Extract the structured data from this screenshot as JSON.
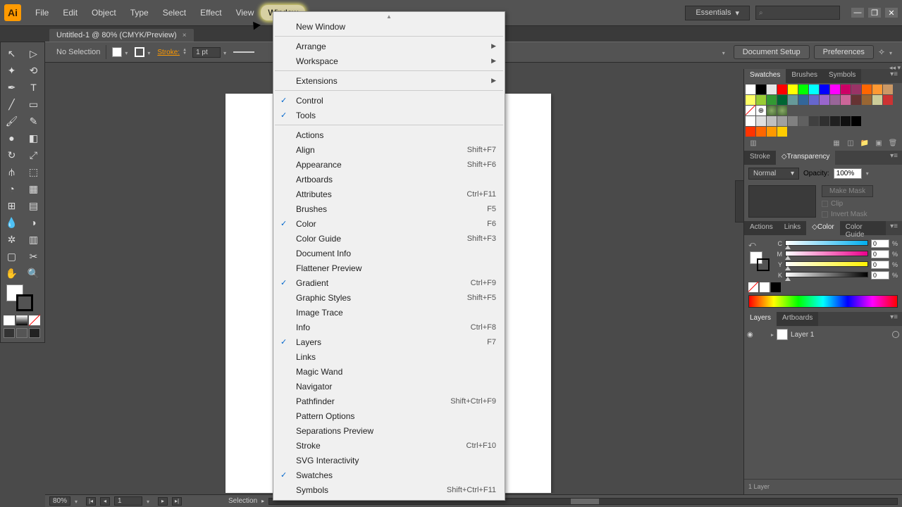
{
  "app": {
    "logo": "Ai"
  },
  "menu": {
    "items": [
      "File",
      "Edit",
      "Object",
      "Type",
      "Select",
      "Effect",
      "View",
      "Window"
    ],
    "active_index": 7
  },
  "workspace_switcher": "Essentials",
  "doc_tab": {
    "title": "Untitled-1 @ 80% (CMYK/Preview)"
  },
  "controlbar": {
    "selection": "No Selection",
    "stroke_label": "Stroke:",
    "stroke_weight": "1 pt",
    "doc_setup": "Document Setup",
    "prefs": "Preferences"
  },
  "window_menu": {
    "groups": [
      {
        "items": [
          {
            "label": "New Window"
          }
        ]
      },
      {
        "items": [
          {
            "label": "Arrange",
            "sub": true
          },
          {
            "label": "Workspace",
            "sub": true
          }
        ]
      },
      {
        "items": [
          {
            "label": "Extensions",
            "sub": true
          }
        ]
      },
      {
        "items": [
          {
            "label": "Control",
            "checked": true
          },
          {
            "label": "Tools",
            "checked": true
          }
        ]
      },
      {
        "items": [
          {
            "label": "Actions"
          },
          {
            "label": "Align",
            "shortcut": "Shift+F7"
          },
          {
            "label": "Appearance",
            "shortcut": "Shift+F6"
          },
          {
            "label": "Artboards"
          },
          {
            "label": "Attributes",
            "shortcut": "Ctrl+F11"
          },
          {
            "label": "Brushes",
            "shortcut": "F5"
          },
          {
            "label": "Color",
            "checked": true,
            "shortcut": "F6"
          },
          {
            "label": "Color Guide",
            "shortcut": "Shift+F3"
          },
          {
            "label": "Document Info"
          },
          {
            "label": "Flattener Preview"
          },
          {
            "label": "Gradient",
            "checked": true,
            "shortcut": "Ctrl+F9"
          },
          {
            "label": "Graphic Styles",
            "shortcut": "Shift+F5"
          },
          {
            "label": "Image Trace"
          },
          {
            "label": "Info",
            "shortcut": "Ctrl+F8"
          },
          {
            "label": "Layers",
            "checked": true,
            "shortcut": "F7"
          },
          {
            "label": "Links"
          },
          {
            "label": "Magic Wand"
          },
          {
            "label": "Navigator"
          },
          {
            "label": "Pathfinder",
            "shortcut": "Shift+Ctrl+F9"
          },
          {
            "label": "Pattern Options"
          },
          {
            "label": "Separations Preview"
          },
          {
            "label": "Stroke",
            "shortcut": "Ctrl+F10"
          },
          {
            "label": "SVG Interactivity"
          },
          {
            "label": "Swatches",
            "checked": true
          },
          {
            "label": "Symbols",
            "shortcut": "Shift+Ctrl+F11"
          }
        ]
      }
    ]
  },
  "panels": {
    "swatches_tabs": [
      "Swatches",
      "Brushes",
      "Symbols"
    ],
    "swatch_colors": [
      "#ffffff",
      "#000000",
      "#e6e6e6",
      "#ff0000",
      "#ffff00",
      "#00ff00",
      "#00ffff",
      "#0000ff",
      "#ff00ff",
      "#cc0066",
      "#993366",
      "#ff6600",
      "#ff9933",
      "#cc9966",
      "#ffff66",
      "#99cc33",
      "#339933",
      "#006633",
      "#669999",
      "#336699",
      "#6666cc",
      "#9966cc",
      "#996699",
      "#cc6699",
      "#663333",
      "#996633",
      "#cccc99",
      "#cc3333",
      "none",
      "reg",
      "spec1",
      "spec2",
      "",
      "",
      "",
      "",
      "",
      "",
      "",
      "",
      "",
      "",
      "#ffffff",
      "#e0e0e0",
      "#c0c0c0",
      "#a0a0a0",
      "#808080",
      "#606060",
      "#404040",
      "#303030",
      "#202020",
      "#101010",
      "#000000",
      "",
      "",
      "",
      "#ff3300",
      "#ff6600",
      "#ff9900",
      "#ffcc00",
      ""
    ],
    "stroke_tabs": [
      "Stroke",
      "Transparency"
    ],
    "blend_mode": "Normal",
    "opacity_label": "Opacity:",
    "opacity_value": "100%",
    "mask_btn": "Make Mask",
    "clip_label": "Clip",
    "invert_label": "Invert Mask",
    "color_tabs": [
      "Actions",
      "Links",
      "Color",
      "Color Guide"
    ],
    "cmyk": {
      "C": "0",
      "M": "0",
      "Y": "0",
      "K": "0"
    },
    "layers_tabs": [
      "Layers",
      "Artboards"
    ],
    "layer_name": "Layer 1",
    "layer_count": "1 Layer"
  },
  "statusbar": {
    "zoom": "80%",
    "artboard": "1",
    "tool": "Selection"
  }
}
